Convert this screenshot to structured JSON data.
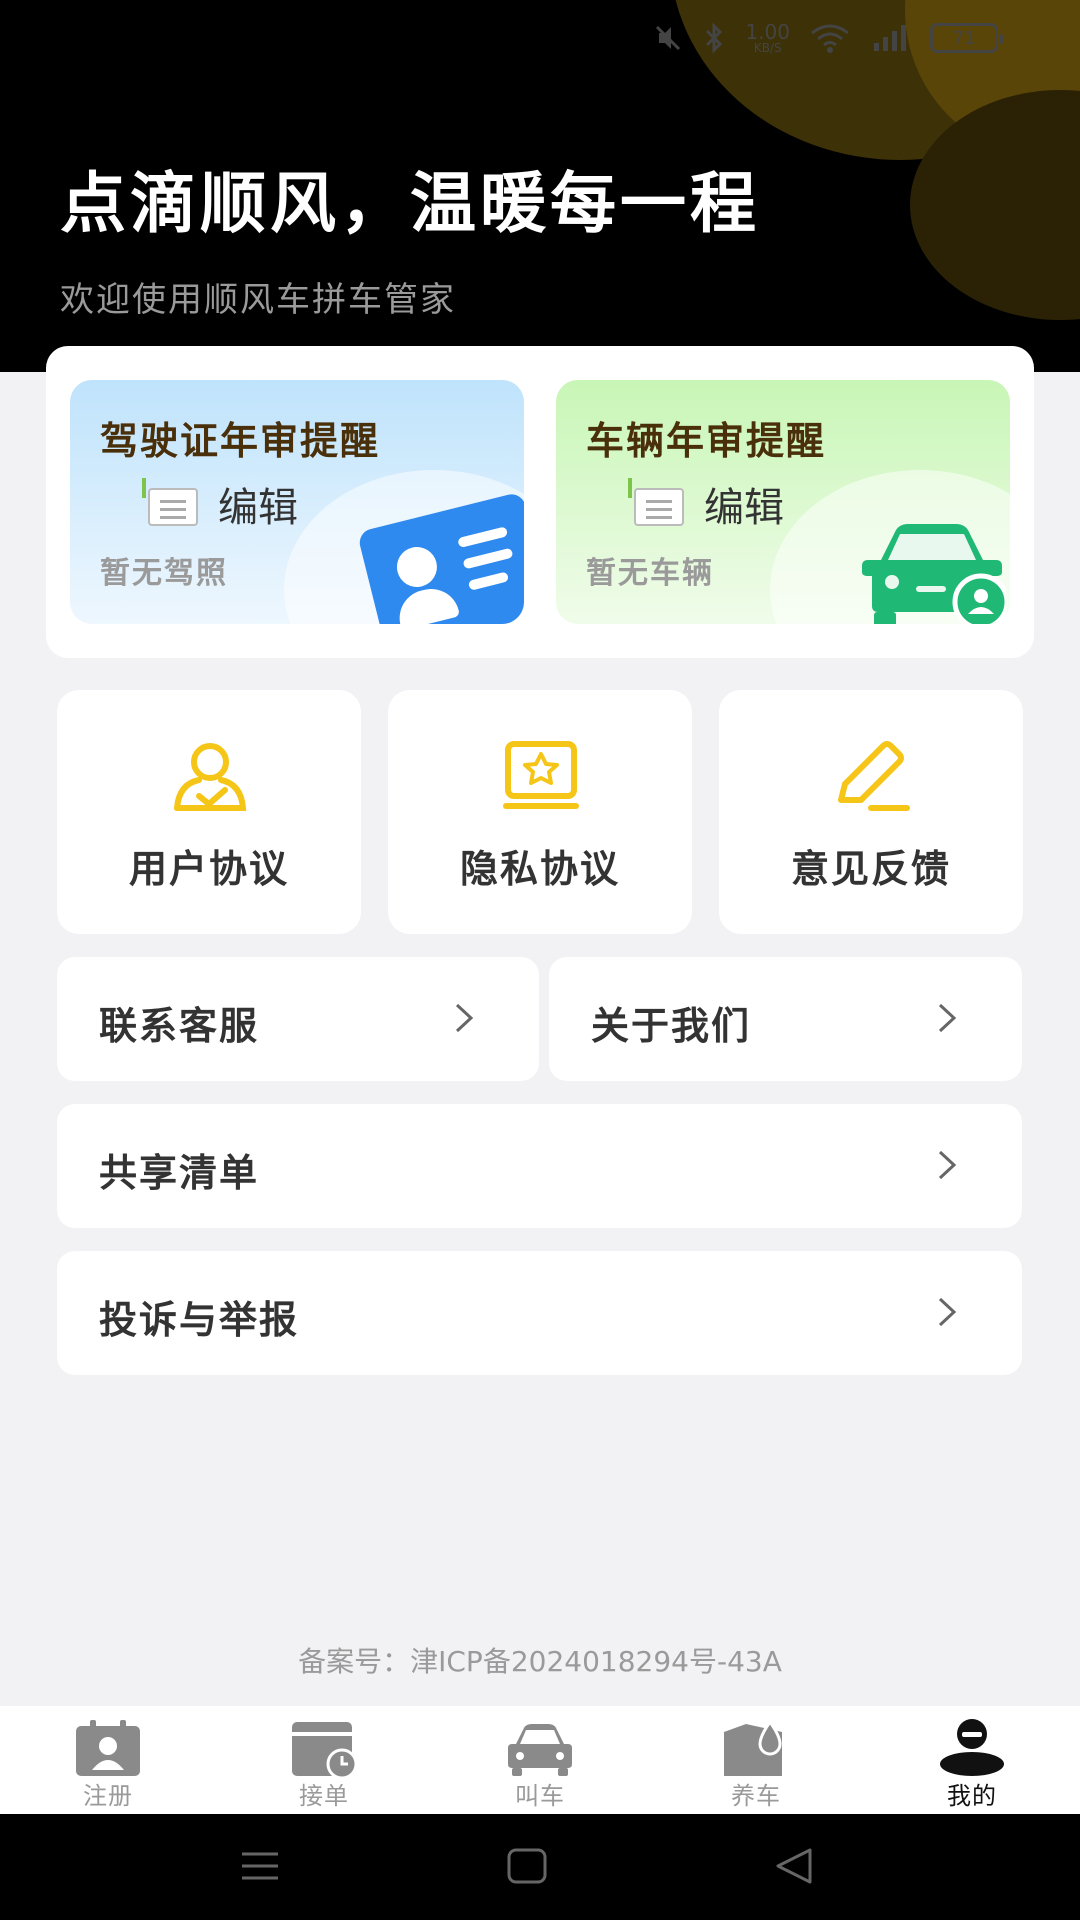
{
  "status_bar": {
    "network_speed": "1.00",
    "network_unit": "KB/S",
    "battery": "71"
  },
  "header": {
    "title": "点滴顺风，温暖每一程",
    "subtitle": "欢迎使用顺风车拼车管家"
  },
  "reminders": [
    {
      "title": "驾驶证年审提醒",
      "edit_label": "编辑",
      "status": "暂无驾照",
      "icon": "id-card-icon"
    },
    {
      "title": "车辆年审提醒",
      "edit_label": "编辑",
      "status": "暂无车辆",
      "icon": "car-owner-icon"
    }
  ],
  "grid": [
    {
      "label": "用户协议",
      "icon": "user-agreement-icon"
    },
    {
      "label": "隐私协议",
      "icon": "privacy-star-icon"
    },
    {
      "label": "意见反馈",
      "icon": "pen-feedback-icon"
    }
  ],
  "rows": {
    "contact": "联系客服",
    "about": "关于我们",
    "share": "共享清单",
    "complaint": "投诉与举报"
  },
  "icp": "备案号：津ICP备2024018294号-43A",
  "tabs": [
    {
      "label": "注册",
      "icon": "register-icon"
    },
    {
      "label": "接单",
      "icon": "calendar-clock-icon"
    },
    {
      "label": "叫车",
      "icon": "car-icon"
    },
    {
      "label": "养车",
      "icon": "car-care-icon"
    },
    {
      "label": "我的",
      "icon": "profile-icon"
    }
  ],
  "colors": {
    "accent": "#f5c518",
    "active_tab": "#111111",
    "inactive": "#9a9a9a",
    "license_blue": "#2f8af0",
    "vehicle_green": "#1fb874"
  }
}
